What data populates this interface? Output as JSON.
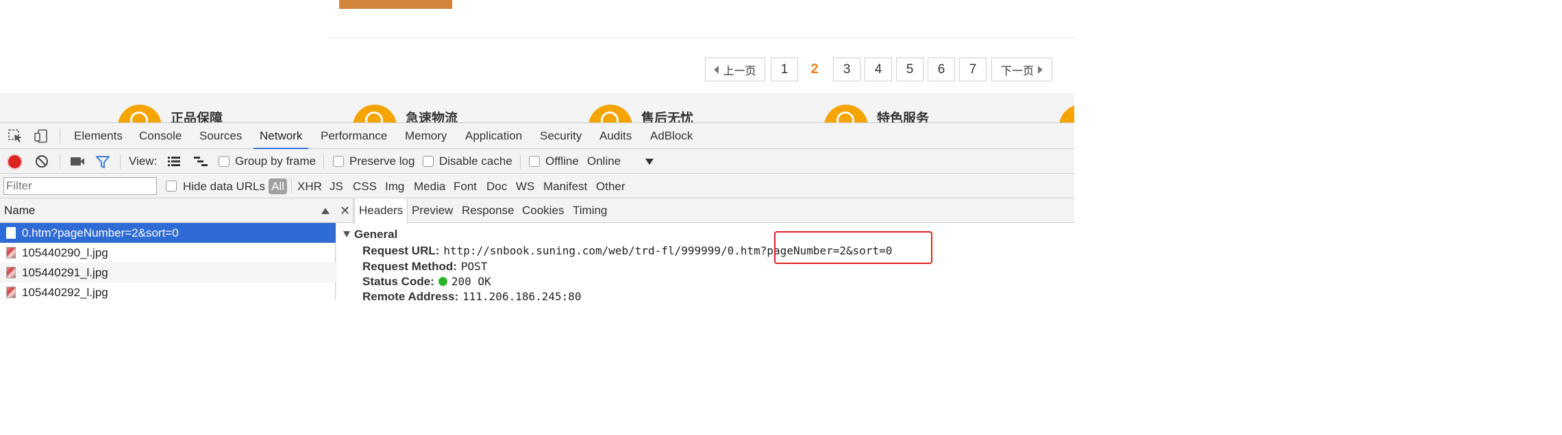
{
  "pagination": {
    "prev_label": "上一页",
    "pages": [
      "1",
      "2",
      "3",
      "4",
      "5",
      "6",
      "7"
    ],
    "current": "2",
    "next_label": "下一页"
  },
  "services": [
    {
      "label": "正品保障",
      "icon": "shield-icon"
    },
    {
      "label": "急速物流",
      "icon": "truck-icon"
    },
    {
      "label": "售后无忧",
      "icon": "wrench-icon"
    },
    {
      "label": "特色服务",
      "icon": "star-icon"
    }
  ],
  "devtools": {
    "tabs": [
      "Elements",
      "Console",
      "Sources",
      "Network",
      "Performance",
      "Memory",
      "Application",
      "Security",
      "Audits",
      "AdBlock"
    ],
    "active_tab": "Network",
    "controls": {
      "view_label": "View:",
      "group_by_frame": "Group by frame",
      "preserve_log": "Preserve log",
      "disable_cache": "Disable cache",
      "offline": "Offline",
      "throttle": "Online"
    },
    "filter": {
      "placeholder": "Filter",
      "hide_data_urls": "Hide data URLs",
      "types": [
        "All",
        "XHR",
        "JS",
        "CSS",
        "Img",
        "Media",
        "Font",
        "Doc",
        "WS",
        "Manifest",
        "Other"
      ]
    },
    "name_column": "Name",
    "requests": [
      {
        "name": "0.htm?pageNumber=2&sort=0",
        "selected": true
      },
      {
        "name": "105440290_l.jpg",
        "selected": false
      },
      {
        "name": "105440291_l.jpg",
        "selected": false
      },
      {
        "name": "105440292_l.jpg",
        "selected": false
      }
    ],
    "detail_tabs": [
      "Headers",
      "Preview",
      "Response",
      "Cookies",
      "Timing"
    ],
    "general_label": "General",
    "headers": {
      "request_url_key": "Request URL:",
      "request_url_value": "http://snbook.suning.com/web/trd-fl/999999/0.htm?pageNumber=2&sort=0",
      "request_method_key": "Request Method:",
      "request_method_value": "POST",
      "status_code_key": "Status Code:",
      "status_code_value": "200 OK",
      "remote_address_key": "Remote Address:",
      "remote_address_value": "111.206.186.245:80"
    }
  },
  "colors": {
    "accent_orange": "#f07f1f",
    "devtools_blue": "#3879d9",
    "selection_blue": "#2f6bd4",
    "highlight_red": "#e21e1e"
  }
}
